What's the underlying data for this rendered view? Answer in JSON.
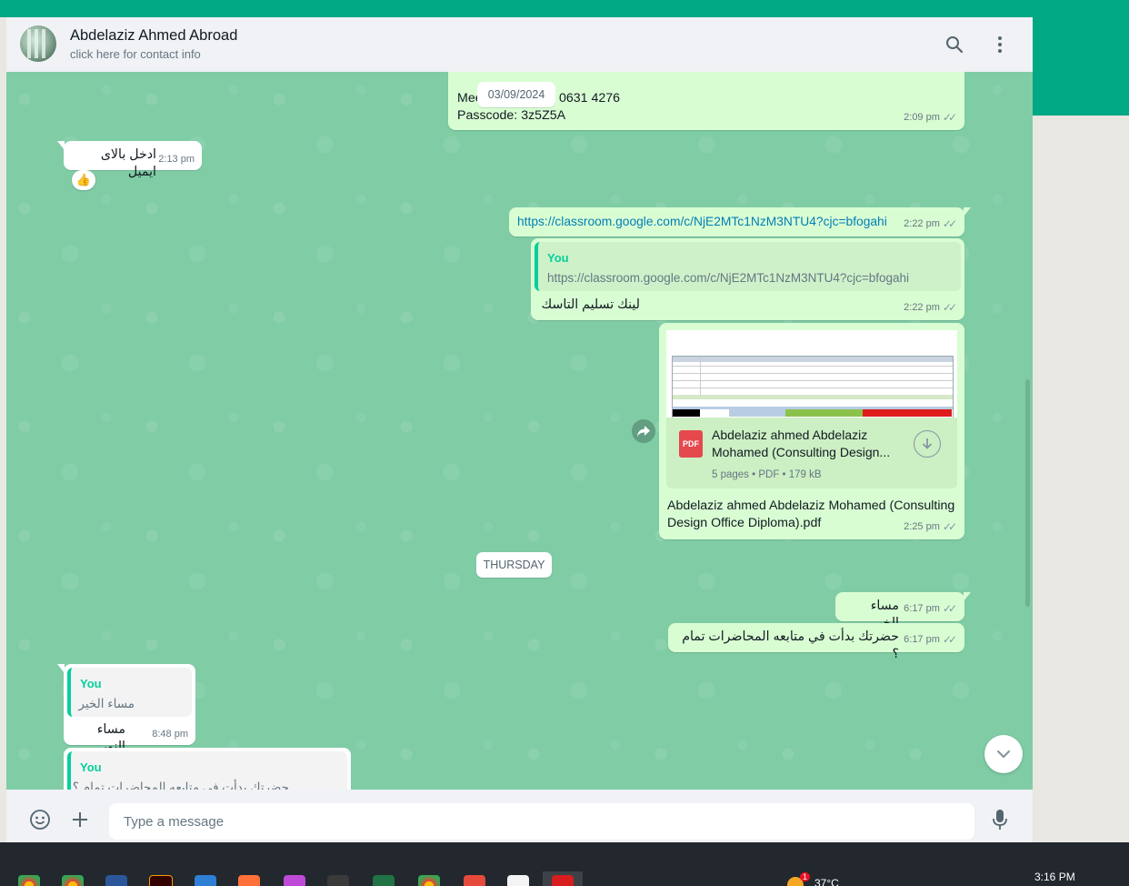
{
  "header": {
    "contact_name": "Abdelaziz Ahmed Abroad",
    "subtitle": "click here for contact info",
    "search_icon": "search-icon",
    "menu_icon": "kebab-menu-icon"
  },
  "messages": {
    "m1": {
      "line1_start": "Mee",
      "line1_end": "0631 4276",
      "line2": "Passcode: 3z5Z5A",
      "time": "2:09 pm"
    },
    "sticky_date": "03/09/2024",
    "m2": {
      "text": "ادخل بالاى ايميل",
      "time": "2:13 pm",
      "reaction": "👍"
    },
    "m3": {
      "link": "https://classroom.google.com/c/NjE2MTc1NzM3NTU4?cjc=bfogahi",
      "time": "2:22 pm"
    },
    "m4": {
      "quote_author": "You",
      "quote_text": "https://classroom.google.com/c/NjE2MTc1NzM3NTU4?cjc=bfogahi",
      "text": "لينك تسليم التاسك",
      "time": "2:22 pm"
    },
    "m5": {
      "file_name": "Abdelaziz ahmed Abdelaziz Mohamed (Consulting Design...",
      "file_info": "5 pages • PDF • 179 kB",
      "file_badge": "PDF",
      "caption": "Abdelaziz ahmed Abdelaziz Mohamed (Consulting Design Office Diploma).pdf",
      "time": "2:25 pm"
    },
    "day_separator": "THURSDAY",
    "m6": {
      "text": "مساء الخير",
      "time": "6:17 pm"
    },
    "m7": {
      "text": "حضرتك بدأت في متابعه المحاضرات تمام ؟",
      "time": "6:17 pm"
    },
    "m8": {
      "quote_author": "You",
      "quote_text": "مساء الخير",
      "text": "مساء النور",
      "time": "8:48 pm"
    },
    "m9": {
      "quote_author": "You",
      "quote_text": "حضرتك بدأت في متابعه المحاضرات تمام ؟"
    }
  },
  "composer": {
    "placeholder": "Type a message",
    "emoji_icon": "smiley-icon",
    "attach_icon": "plus-icon",
    "mic_icon": "microphone-icon"
  },
  "taskbar": {
    "weather": "37°C",
    "time": "3:16 PM",
    "notification_count": "1"
  },
  "colors": {
    "accent": "#00a884",
    "chat_background": "#7fcca5",
    "outgoing_bubble": "#d9fdd3",
    "incoming_bubble": "#ffffff",
    "quote_bar": "#06cf9c",
    "link": "#027eb5"
  }
}
